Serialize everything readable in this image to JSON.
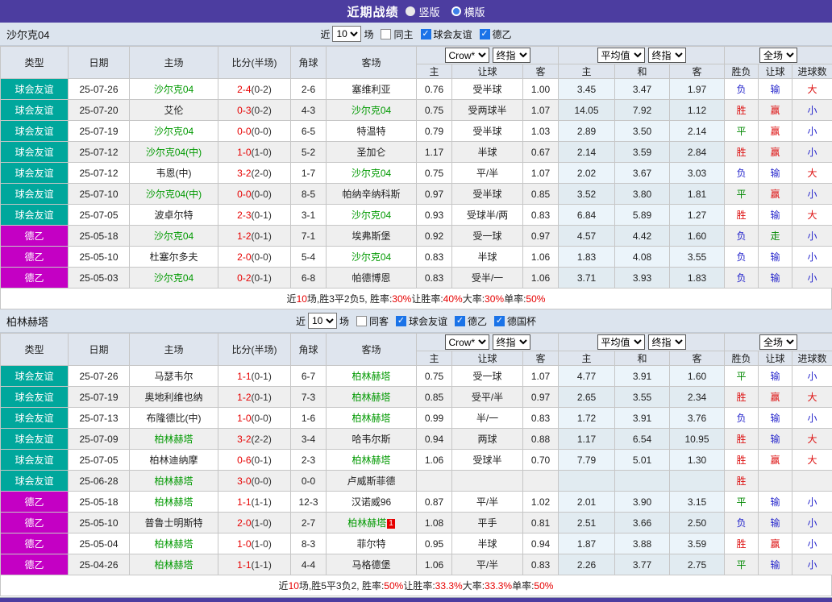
{
  "topbar": {
    "title": "近期战绩",
    "radios": [
      {
        "label": "竖版",
        "selected": true
      },
      {
        "label": "横版",
        "selected": false
      }
    ]
  },
  "type_colors": {
    "球会友谊": "#00a79c",
    "德乙": "#c400c4"
  },
  "result_colors": {
    "胜": "#dd1111",
    "赢": "#dd1111",
    "大": "#dd1111",
    "平": "#008800",
    "走": "#008800",
    "负": "#2626cc",
    "输": "#2626cc",
    "小": "#2626cc"
  },
  "table_header": {
    "left_cols": [
      "类型",
      "日期",
      "主场",
      "比分(半场)",
      "角球",
      "客场"
    ],
    "group1_selects": [
      "Crow*",
      "终指"
    ],
    "group1_subcols": [
      "主",
      "让球",
      "客"
    ],
    "group2_selects": [
      "平均值",
      "终指"
    ],
    "group2_subcols": [
      "主",
      "和",
      "客"
    ],
    "group3_selects": [
      "全场"
    ],
    "group3_subcols": [
      "胜负",
      "让球",
      "进球数"
    ]
  },
  "sections": [
    {
      "team": "沙尔克04",
      "filter": {
        "near_label": "近",
        "matches_select": "10",
        "games_label": "场",
        "checkboxes": [
          {
            "label": "同主",
            "checked": false
          },
          {
            "label": "球会友谊",
            "checked": true
          },
          {
            "label": "德乙",
            "checked": true
          }
        ]
      },
      "rows": [
        {
          "type": "球会友谊",
          "date": "25-07-26",
          "home": "沙尔克04",
          "home_focus": true,
          "score": "2-4",
          "half": "(0-2)",
          "corner": "2-6",
          "away": "塞维利亚",
          "away_focus": false,
          "odds": [
            "0.76",
            "受半球",
            "1.00"
          ],
          "avg": [
            "3.45",
            "3.47",
            "1.97"
          ],
          "res": [
            "负",
            "输",
            "大"
          ]
        },
        {
          "type": "球会友谊",
          "date": "25-07-20",
          "home": "艾伦",
          "home_focus": false,
          "score": "0-3",
          "half": "(0-2)",
          "corner": "4-3",
          "away": "沙尔克04",
          "away_focus": true,
          "odds": [
            "0.75",
            "受两球半",
            "1.07"
          ],
          "avg": [
            "14.05",
            "7.92",
            "1.12"
          ],
          "res": [
            "胜",
            "赢",
            "小"
          ]
        },
        {
          "type": "球会友谊",
          "date": "25-07-19",
          "home": "沙尔克04",
          "home_focus": true,
          "score": "0-0",
          "half": "(0-0)",
          "corner": "6-5",
          "away": "特温特",
          "away_focus": false,
          "odds": [
            "0.79",
            "受半球",
            "1.03"
          ],
          "avg": [
            "2.89",
            "3.50",
            "2.14"
          ],
          "res": [
            "平",
            "赢",
            "小"
          ]
        },
        {
          "type": "球会友谊",
          "date": "25-07-12",
          "home": "沙尔克04(中)",
          "home_focus": true,
          "score": "1-0",
          "half": "(1-0)",
          "corner": "5-2",
          "away": "圣加仑",
          "away_focus": false,
          "odds": [
            "1.17",
            "半球",
            "0.67"
          ],
          "avg": [
            "2.14",
            "3.59",
            "2.84"
          ],
          "res": [
            "胜",
            "赢",
            "小"
          ]
        },
        {
          "type": "球会友谊",
          "date": "25-07-12",
          "home": "韦恩(中)",
          "home_focus": false,
          "score": "3-2",
          "half": "(2-0)",
          "corner": "1-7",
          "away": "沙尔克04",
          "away_focus": true,
          "odds": [
            "0.75",
            "平/半",
            "1.07"
          ],
          "avg": [
            "2.02",
            "3.67",
            "3.03"
          ],
          "res": [
            "负",
            "输",
            "大"
          ]
        },
        {
          "type": "球会友谊",
          "date": "25-07-10",
          "home": "沙尔克04(中)",
          "home_focus": true,
          "score": "0-0",
          "half": "(0-0)",
          "corner": "8-5",
          "away": "帕纳辛纳科斯",
          "away_focus": false,
          "odds": [
            "0.97",
            "受半球",
            "0.85"
          ],
          "avg": [
            "3.52",
            "3.80",
            "1.81"
          ],
          "res": [
            "平",
            "赢",
            "小"
          ]
        },
        {
          "type": "球会友谊",
          "date": "25-07-05",
          "home": "波卓尔特",
          "home_focus": false,
          "score": "2-3",
          "half": "(0-1)",
          "corner": "3-1",
          "away": "沙尔克04",
          "away_focus": true,
          "odds": [
            "0.93",
            "受球半/两",
            "0.83"
          ],
          "avg": [
            "6.84",
            "5.89",
            "1.27"
          ],
          "res": [
            "胜",
            "输",
            "大"
          ]
        },
        {
          "type": "德乙",
          "date": "25-05-18",
          "home": "沙尔克04",
          "home_focus": true,
          "score": "1-2",
          "half": "(0-1)",
          "corner": "7-1",
          "away": "埃弗斯堡",
          "away_focus": false,
          "odds": [
            "0.92",
            "受一球",
            "0.97"
          ],
          "avg": [
            "4.57",
            "4.42",
            "1.60"
          ],
          "res": [
            "负",
            "走",
            "小"
          ]
        },
        {
          "type": "德乙",
          "date": "25-05-10",
          "home": "杜塞尔多夫",
          "home_focus": false,
          "score": "2-0",
          "half": "(0-0)",
          "corner": "5-4",
          "away": "沙尔克04",
          "away_focus": true,
          "odds": [
            "0.83",
            "半球",
            "1.06"
          ],
          "avg": [
            "1.83",
            "4.08",
            "3.55"
          ],
          "res": [
            "负",
            "输",
            "小"
          ]
        },
        {
          "type": "德乙",
          "date": "25-05-03",
          "home": "沙尔克04",
          "home_focus": true,
          "score": "0-2",
          "half": "(0-1)",
          "corner": "6-8",
          "away": "帕德博恩",
          "away_focus": false,
          "odds": [
            "0.83",
            "受半/一",
            "1.06"
          ],
          "avg": [
            "3.71",
            "3.93",
            "1.83"
          ],
          "res": [
            "负",
            "输",
            "小"
          ]
        }
      ],
      "summary": [
        {
          "t": "近",
          "r": false
        },
        {
          "t": "10",
          "r": true
        },
        {
          "t": "场,胜3平2负5, 胜率:",
          "r": false
        },
        {
          "t": "30%",
          "r": true
        },
        {
          "t": " 让胜率:",
          "r": false
        },
        {
          "t": "40%",
          "r": true
        },
        {
          "t": " 大率:",
          "r": false
        },
        {
          "t": "30%",
          "r": true
        },
        {
          "t": " 单率:",
          "r": false
        },
        {
          "t": "50%",
          "r": true
        }
      ]
    },
    {
      "team": "柏林赫塔",
      "filter": {
        "near_label": "近",
        "matches_select": "10",
        "games_label": "场",
        "checkboxes": [
          {
            "label": "同客",
            "checked": false
          },
          {
            "label": "球会友谊",
            "checked": true
          },
          {
            "label": "德乙",
            "checked": true
          },
          {
            "label": "德国杯",
            "checked": true
          }
        ]
      },
      "rows": [
        {
          "type": "球会友谊",
          "date": "25-07-26",
          "home": "马瑟韦尔",
          "home_focus": false,
          "score": "1-1",
          "half": "(0-1)",
          "corner": "6-7",
          "away": "柏林赫塔",
          "away_focus": true,
          "odds": [
            "0.75",
            "受一球",
            "1.07"
          ],
          "avg": [
            "4.77",
            "3.91",
            "1.60"
          ],
          "res": [
            "平",
            "输",
            "小"
          ]
        },
        {
          "type": "球会友谊",
          "date": "25-07-19",
          "home": "奥地利维也纳",
          "home_focus": false,
          "score": "1-2",
          "half": "(0-1)",
          "corner": "7-3",
          "away": "柏林赫塔",
          "away_focus": true,
          "odds": [
            "0.85",
            "受平/半",
            "0.97"
          ],
          "avg": [
            "2.65",
            "3.55",
            "2.34"
          ],
          "res": [
            "胜",
            "赢",
            "大"
          ]
        },
        {
          "type": "球会友谊",
          "date": "25-07-13",
          "home": "布隆德比(中)",
          "home_focus": false,
          "score": "1-0",
          "half": "(0-0)",
          "corner": "1-6",
          "away": "柏林赫塔",
          "away_focus": true,
          "odds": [
            "0.99",
            "半/一",
            "0.83"
          ],
          "avg": [
            "1.72",
            "3.91",
            "3.76"
          ],
          "res": [
            "负",
            "输",
            "小"
          ]
        },
        {
          "type": "球会友谊",
          "date": "25-07-09",
          "home": "柏林赫塔",
          "home_focus": true,
          "score": "3-2",
          "half": "(2-2)",
          "corner": "3-4",
          "away": "哈韦尔斯",
          "away_focus": false,
          "odds": [
            "0.94",
            "两球",
            "0.88"
          ],
          "avg": [
            "1.17",
            "6.54",
            "10.95"
          ],
          "res": [
            "胜",
            "输",
            "大"
          ]
        },
        {
          "type": "球会友谊",
          "date": "25-07-05",
          "home": "柏林迪纳摩",
          "home_focus": false,
          "score": "0-6",
          "half": "(0-1)",
          "corner": "2-3",
          "away": "柏林赫塔",
          "away_focus": true,
          "odds": [
            "1.06",
            "受球半",
            "0.70"
          ],
          "avg": [
            "7.79",
            "5.01",
            "1.30"
          ],
          "res": [
            "胜",
            "赢",
            "大"
          ]
        },
        {
          "type": "球会友谊",
          "date": "25-06-28",
          "home": "柏林赫塔",
          "home_focus": true,
          "score": "3-0",
          "half": "(0-0)",
          "corner": "0-0",
          "away": "卢威斯菲德",
          "away_focus": false,
          "odds": [
            "",
            "",
            ""
          ],
          "avg": [
            "",
            "",
            ""
          ],
          "res": [
            "胜",
            "",
            ""
          ]
        },
        {
          "type": "德乙",
          "date": "25-05-18",
          "home": "柏林赫塔",
          "home_focus": true,
          "score": "1-1",
          "half": "(1-1)",
          "corner": "12-3",
          "away": "汉诺威96",
          "away_focus": false,
          "odds": [
            "0.87",
            "平/半",
            "1.02"
          ],
          "avg": [
            "2.01",
            "3.90",
            "3.15"
          ],
          "res": [
            "平",
            "输",
            "小"
          ]
        },
        {
          "type": "德乙",
          "date": "25-05-10",
          "home": "普鲁士明斯特",
          "home_focus": false,
          "score": "2-0",
          "half": "(1-0)",
          "corner": "2-7",
          "away": "柏林赫塔",
          "away_focus": true,
          "away_badge": "1",
          "odds": [
            "1.08",
            "平手",
            "0.81"
          ],
          "avg": [
            "2.51",
            "3.66",
            "2.50"
          ],
          "res": [
            "负",
            "输",
            "小"
          ]
        },
        {
          "type": "德乙",
          "date": "25-05-04",
          "home": "柏林赫塔",
          "home_focus": true,
          "score": "1-0",
          "half": "(1-0)",
          "corner": "8-3",
          "away": "菲尔特",
          "away_focus": false,
          "odds": [
            "0.95",
            "半球",
            "0.94"
          ],
          "avg": [
            "1.87",
            "3.88",
            "3.59"
          ],
          "res": [
            "胜",
            "赢",
            "小"
          ]
        },
        {
          "type": "德乙",
          "date": "25-04-26",
          "home": "柏林赫塔",
          "home_focus": true,
          "score": "1-1",
          "half": "(1-1)",
          "corner": "4-4",
          "away": "马格德堡",
          "away_focus": false,
          "odds": [
            "1.06",
            "平/半",
            "0.83"
          ],
          "avg": [
            "2.26",
            "3.77",
            "2.75"
          ],
          "res": [
            "平",
            "输",
            "小"
          ]
        }
      ],
      "summary": [
        {
          "t": "近",
          "r": false
        },
        {
          "t": "10",
          "r": true
        },
        {
          "t": "场,胜5平3负2, 胜率:",
          "r": false
        },
        {
          "t": "50%",
          "r": true
        },
        {
          "t": " 让胜率:",
          "r": false
        },
        {
          "t": "33.3%",
          "r": true
        },
        {
          "t": " 大率:",
          "r": false
        },
        {
          "t": "33.3%",
          "r": true
        },
        {
          "t": " 单率:",
          "r": false
        },
        {
          "t": "50%",
          "r": true
        }
      ]
    }
  ]
}
